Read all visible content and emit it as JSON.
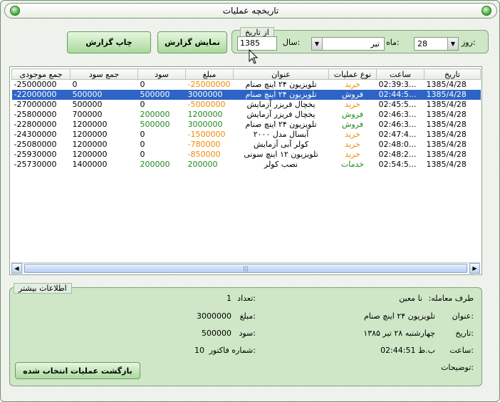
{
  "window": {
    "title": "تاریخچه عملیات"
  },
  "toolbar": {
    "print_label": "چاپ گزارش",
    "show_label": "نمایش گزارش"
  },
  "filter": {
    "legend": "از تاریخ",
    "day_label": "روز:",
    "day_value": "28",
    "month_label": "ماه:",
    "month_value": "تیر",
    "year_label": "سال:",
    "year_value": "1385"
  },
  "grid": {
    "columns": [
      "تاریخ",
      "ساعت",
      "نوع عملیات",
      "عنوان",
      "مبلغ",
      "سود",
      "جمع سود",
      "جمع موجودی"
    ],
    "rows": [
      {
        "date": "1385/4/28",
        "time": "02:39:3...",
        "type": "خرید",
        "type_color": "orange",
        "title": "تلویزیون ۲۴ اینچ صنام",
        "amount": "-25000000",
        "amount_color": "orange",
        "profit": "0",
        "profit_color": "",
        "sumprofit": "0",
        "balance": "-25000000"
      },
      {
        "date": "1385/4/28",
        "time": "02:44:5...",
        "type": "فروش",
        "type_color": "green",
        "title": "تلویزیون ۲۴ اینچ صنام",
        "amount": "3000000",
        "amount_color": "green",
        "profit": "500000",
        "profit_color": "green",
        "sumprofit": "500000",
        "balance": "-22000000"
      },
      {
        "date": "1385/4/28",
        "time": "02:45:5...",
        "type": "خرید",
        "type_color": "orange",
        "title": "یخچال فریزر آزمایش",
        "amount": "-5000000",
        "amount_color": "orange",
        "profit": "0",
        "profit_color": "",
        "sumprofit": "500000",
        "balance": "-27000000"
      },
      {
        "date": "1385/4/28",
        "time": "02:46:3...",
        "type": "فروش",
        "type_color": "green",
        "title": "یخچال فریزر آزمایش",
        "amount": "1200000",
        "amount_color": "green",
        "profit": "200000",
        "profit_color": "green",
        "sumprofit": "700000",
        "balance": "-25800000"
      },
      {
        "date": "1385/4/28",
        "time": "02:46:3...",
        "type": "فروش",
        "type_color": "green",
        "title": "تلویزیون ۲۴ اینچ صنام",
        "amount": "3000000",
        "amount_color": "green",
        "profit": "500000",
        "profit_color": "green",
        "sumprofit": "1200000",
        "balance": "-22800000"
      },
      {
        "date": "1385/4/28",
        "time": "02:47:4...",
        "type": "خرید",
        "type_color": "orange",
        "title": "آبسال مدل ۲۰۰۰",
        "amount": "-1500000",
        "amount_color": "orange",
        "profit": "0",
        "profit_color": "",
        "sumprofit": "1200000",
        "balance": "-24300000"
      },
      {
        "date": "1385/4/28",
        "time": "02:48:0...",
        "type": "خرید",
        "type_color": "orange",
        "title": "کولر آبی آزمایش",
        "amount": "-780000",
        "amount_color": "orange",
        "profit": "0",
        "profit_color": "",
        "sumprofit": "1200000",
        "balance": "-25080000"
      },
      {
        "date": "1385/4/28",
        "time": "02:48:2...",
        "type": "خرید",
        "type_color": "orange",
        "title": "تلویزیون ۱۲ اینچ سونی",
        "amount": "-850000",
        "amount_color": "orange",
        "profit": "0",
        "profit_color": "",
        "sumprofit": "1200000",
        "balance": "-25930000"
      },
      {
        "date": "1385/4/28",
        "time": "02:54:5...",
        "type": "خدمات",
        "type_color": "green",
        "title": "نصب کولر",
        "amount": "200000",
        "amount_color": "green",
        "profit": "200000",
        "profit_color": "green",
        "sumprofit": "1400000",
        "balance": "-25730000"
      }
    ],
    "selected_row": 1
  },
  "info": {
    "legend": "اطلاعات بیشتر",
    "party_label": "طرف معامله:",
    "party_value": "نا معین",
    "count_label": "تعداد:",
    "count_value": "1",
    "title_label": "عنوان:",
    "title_value": "تلویزیون ۲۴ اینچ صنام",
    "amount_label": "مبلغ:",
    "amount_value": "3000000",
    "date_label": "تاریخ:",
    "date_value": "چهارشنبه ۲۸ تیر ۱۳۸۵",
    "profit_label": "سود:",
    "profit_value": "500000",
    "time_label": "ساعت:",
    "time_value": "02:44:51 ب.ظ",
    "invoice_label": "شماره فاکتور:",
    "invoice_value": "10",
    "notes_label": "توضیحات:",
    "back_button": "بازگشت عملیات انتخاب شده"
  },
  "colors": {
    "orange": "#f08a00",
    "green": "#1e8a1e",
    "selection": "#2e64c5",
    "panel": "#cfe7c6"
  }
}
